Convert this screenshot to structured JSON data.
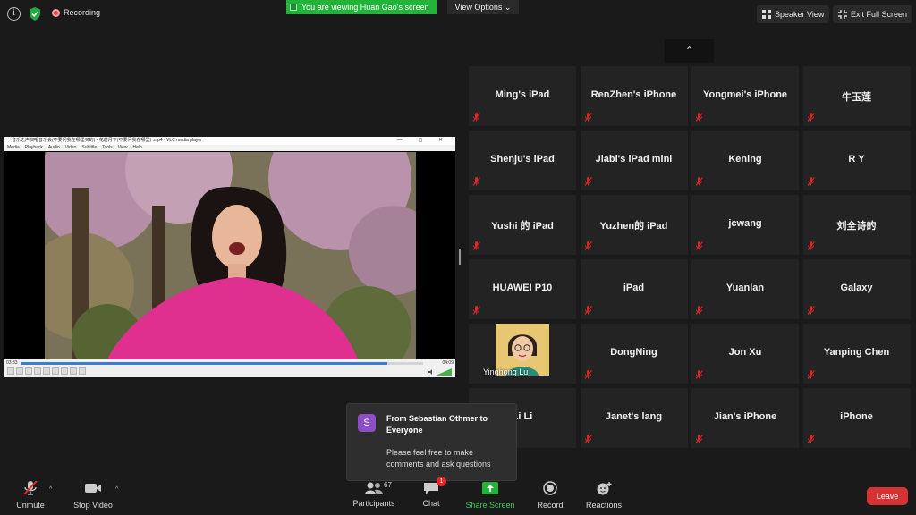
{
  "topbar": {
    "info_glyph": "i",
    "recording_label": "Recording",
    "viewing_banner": "You are viewing Huan Gao's screen",
    "view_options": "View Options",
    "view_options_caret": "⌄",
    "speaker_view": "Speaker View",
    "exit_full_screen": "Exit Full Screen",
    "up_arrow": "⌃"
  },
  "vlc": {
    "title": "音乐之声演唱音乐会(不要问我在哪里买的) - 花前月下(不要问我在哪里) .mp4 - VLC media player",
    "window_controls": "— ◻ ✕",
    "menu": [
      "Media",
      "Playback",
      "Audio",
      "Video",
      "Subtitle",
      "Tools",
      "View",
      "Help"
    ],
    "time_elapsed": "03:33",
    "time_total": "04:09",
    "progress": 0.91
  },
  "grid": {
    "tiles": [
      {
        "name": "Ming's iPad"
      },
      {
        "name": "RenZhen's iPhone"
      },
      {
        "name": "Yongmei's iPhone"
      },
      {
        "name": "牛玉莲"
      },
      {
        "name": "Shenju's iPad"
      },
      {
        "name": "Jiabi's iPad mini"
      },
      {
        "name": "Kening"
      },
      {
        "name": "R Y"
      },
      {
        "name": "Yushi 的 iPad"
      },
      {
        "name": "Yuzhen的 iPad"
      },
      {
        "name": "jcwang"
      },
      {
        "name": "刘全诗的"
      },
      {
        "name": "HUAWEI P10"
      },
      {
        "name": "iPad"
      },
      {
        "name": "Yuanlan"
      },
      {
        "name": "Galaxy"
      },
      {
        "name": "",
        "label": "Yinghong Lu",
        "avatar": true
      },
      {
        "name": "DongNing"
      },
      {
        "name": "Jon Xu"
      },
      {
        "name": "Yanping Chen"
      },
      {
        "name": "Li Li"
      },
      {
        "name": "Janet's lang"
      },
      {
        "name": "Jian's iPhone"
      },
      {
        "name": "iPhone"
      }
    ]
  },
  "chat_toast": {
    "avatar_initial": "S",
    "from": "From Sebastian Othmer to Everyone",
    "message": "Please feel free to make comments and ask questions"
  },
  "bottombar": {
    "unmute": "Unmute",
    "stop_video": "Stop Video",
    "participants": "Participants",
    "participants_count": "67",
    "chat": "Chat",
    "chat_badge": "1",
    "share_screen": "Share Screen",
    "record": "Record",
    "reactions": "Reactions",
    "leave": "Leave",
    "caret": "^"
  },
  "colors": {
    "background": "#1a1a1a",
    "tile": "#232323",
    "banner_green": "#23b33a",
    "share_green": "#23b33a",
    "leave_red": "#d63434",
    "muted_red": "#e02828"
  }
}
